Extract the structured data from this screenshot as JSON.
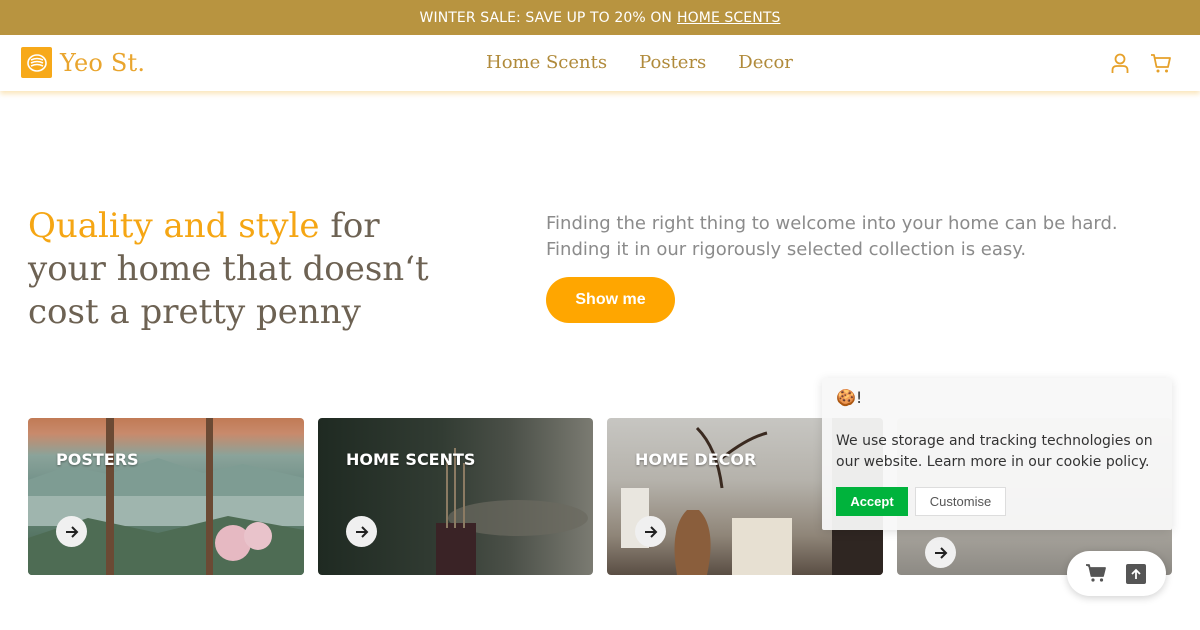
{
  "announcement": {
    "text": "WINTER SALE: SAVE UP TO 20% ON",
    "link": "HOME SCENTS"
  },
  "header": {
    "brand": "Yeo St.",
    "nav": [
      "Home Scents",
      "Posters",
      "Decor"
    ],
    "icons": [
      "account-icon",
      "cart-icon"
    ]
  },
  "hero": {
    "title_accent": "Quality and style",
    "title_rest": " for your home that doesn‘t cost a pretty penny",
    "description": "Finding the right thing to welcome into your home can be hard. Finding it in our rigorously selected collection is easy.",
    "cta": "Show me"
  },
  "categories": [
    {
      "label": "POSTERS"
    },
    {
      "label": "HOME SCENTS"
    },
    {
      "label": "HOME DECOR"
    },
    {
      "label": ""
    }
  ],
  "cookie": {
    "title": "🍪!",
    "text": "We use storage and tracking technologies on our website. Learn more in our cookie policy.",
    "accept": "Accept",
    "customise": "Customise"
  },
  "colors": {
    "brand": "#f5a614",
    "banner": "#b89440",
    "accept": "#00b33c"
  }
}
